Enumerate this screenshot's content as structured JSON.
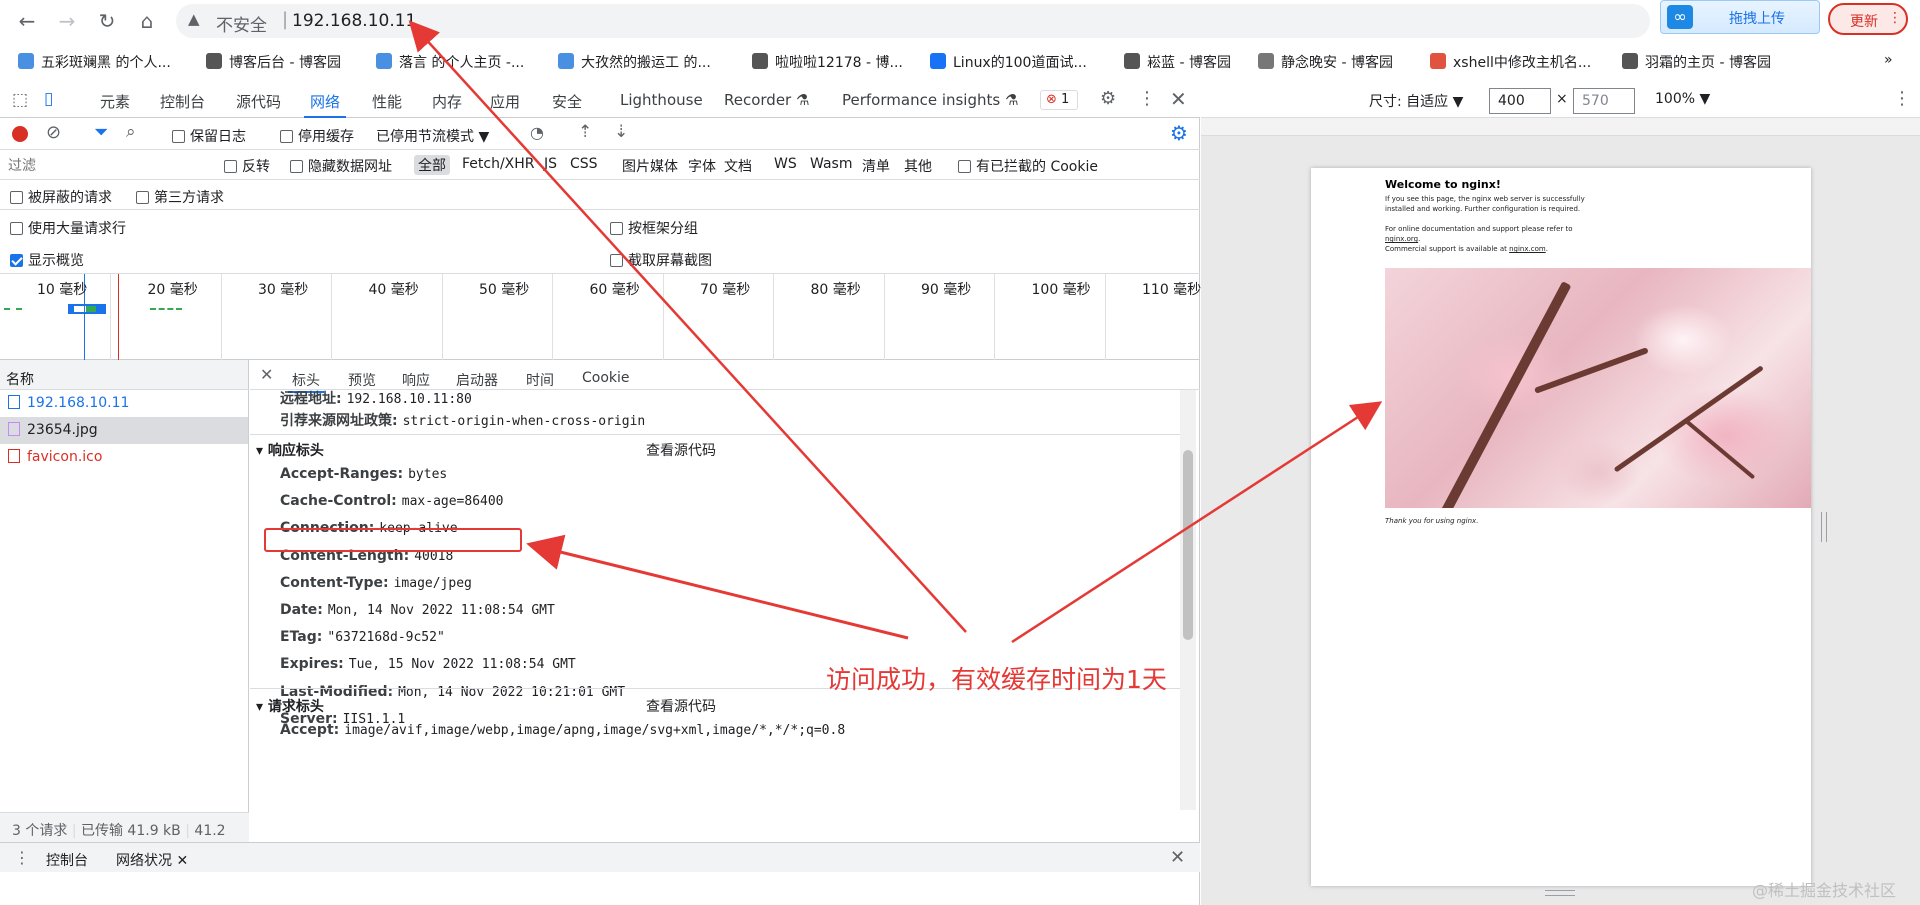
{
  "browser": {
    "insecure_label": "不安全",
    "separator": "|",
    "url": "192.168.10.11",
    "upload_label": "拖拽上传",
    "update_label": "更新"
  },
  "bookmarks": [
    {
      "label": "五彩斑斓黑 的个人...",
      "color": "#4a90e2"
    },
    {
      "label": "博客后台 - 博客园",
      "color": "#555555"
    },
    {
      "label": "落言 的个人主页 -...",
      "color": "#4a90e2"
    },
    {
      "label": "大孜然的搬运工 的...",
      "color": "#4a90e2"
    },
    {
      "label": "啦啦啦12178 - 博...",
      "color": "#555555"
    },
    {
      "label": "Linux的100道面试...",
      "color": "#1772f6"
    },
    {
      "label": "崧蓝 - 博客园",
      "color": "#555555"
    },
    {
      "label": "静念晚安 - 博客园",
      "color": "#777777"
    },
    {
      "label": "xshell中修改主机名...",
      "color": "#e0533e"
    },
    {
      "label": "羽霜的主页 - 博客园",
      "color": "#555555"
    }
  ],
  "bookmarks_more": "»",
  "devtools": {
    "tabs": [
      "元素",
      "控制台",
      "源代码",
      "网络",
      "性能",
      "内存",
      "应用",
      "安全",
      "Lighthouse",
      "Recorder ⚗",
      "Performance insights ⚗"
    ],
    "error_count": "1",
    "toolbar": {
      "preserve_log": "保留日志",
      "disable_cache": "停用缓存",
      "throttle": "已停用节流模式"
    },
    "filter": {
      "placeholder": "过滤",
      "invert": "反转",
      "hide_data_urls": "隐藏数据网址",
      "types": [
        "全部",
        "Fetch/XHR",
        "JS",
        "CSS",
        "图片",
        "媒体",
        "字体",
        "文档",
        "WS",
        "Wasm",
        "清单",
        "其他"
      ],
      "blocked_cookies": "有已拦截的 Cookie"
    },
    "row3": {
      "blocked_requests": "被屏蔽的请求",
      "third_party": "第三方请求"
    },
    "row4": {
      "large_rows": "使用大量请求行",
      "group_by_frame": "按框架分组",
      "show_overview": "显示概览",
      "capture_screenshots": "截取屏幕截图"
    },
    "timeline_ticks": [
      "10 毫秒",
      "20 毫秒",
      "30 毫秒",
      "40 毫秒",
      "50 毫秒",
      "60 毫秒",
      "70 毫秒",
      "80 毫秒",
      "90 毫秒",
      "100 毫秒",
      "110 毫秒"
    ],
    "requests_header": "名称",
    "requests": [
      {
        "name": "192.168.10.11",
        "color": "#1a73e8"
      },
      {
        "name": "23654.jpg",
        "color": "#202124"
      },
      {
        "name": "favicon.ico",
        "color": "#d93025"
      }
    ],
    "status": {
      "count": "3 个请求",
      "transferred": "已传输 41.9 kB",
      "size": "41.2"
    },
    "detail_tabs": [
      "标头",
      "预览",
      "响应",
      "启动器",
      "时间",
      "Cookie"
    ],
    "general": [
      {
        "k": "远程地址:",
        "v": "192.168.10.11:80"
      },
      {
        "k": "引荐来源网址政策:",
        "v": "strict-origin-when-cross-origin"
      }
    ],
    "response_headers_title": "响应标头",
    "view_source": "查看源代码",
    "response_headers": [
      {
        "k": "Accept-Ranges:",
        "v": "bytes"
      },
      {
        "k": "Cache-Control:",
        "v": "max-age=86400"
      },
      {
        "k": "Connection:",
        "v": "keep-alive"
      },
      {
        "k": "Content-Length:",
        "v": "40018"
      },
      {
        "k": "Content-Type:",
        "v": "image/jpeg"
      },
      {
        "k": "Date:",
        "v": "Mon, 14 Nov 2022 11:08:54 GMT"
      },
      {
        "k": "ETag:",
        "v": "\"6372168d-9c52\""
      },
      {
        "k": "Expires:",
        "v": "Tue, 15 Nov 2022 11:08:54 GMT"
      },
      {
        "k": "Last-Modified:",
        "v": "Mon, 14 Nov 2022 10:21:01 GMT"
      },
      {
        "k": "Server:",
        "v": "IIS1.1.1"
      }
    ],
    "request_headers_title": "请求标头",
    "request_headers": [
      {
        "k": "Accept:",
        "v": "image/avif,image/webp,image/apng,image/svg+xml,image/*,*/*;q=0.8"
      }
    ],
    "drawer_tabs": [
      "控制台",
      "网络状况"
    ]
  },
  "device": {
    "size_label": "尺寸: 自适应 ▼",
    "width": "400",
    "times": "×",
    "height": "570",
    "zoom": "100% ▼"
  },
  "nginx": {
    "title": "Welcome to nginx!",
    "p1": "If you see this page, the nginx web server is successfully installed and working. Further configuration is required.",
    "p2a": "For online documentation and support please refer to",
    "link1": "nginx.org",
    "p2b": "Commercial support is available at",
    "link2": "nginx.com",
    "thanks": "Thank you for using nginx."
  },
  "annotation": {
    "text": "访问成功，有效缓存时间为1天",
    "color": "#e53935"
  },
  "watermark": "@稀土掘金技术社区"
}
